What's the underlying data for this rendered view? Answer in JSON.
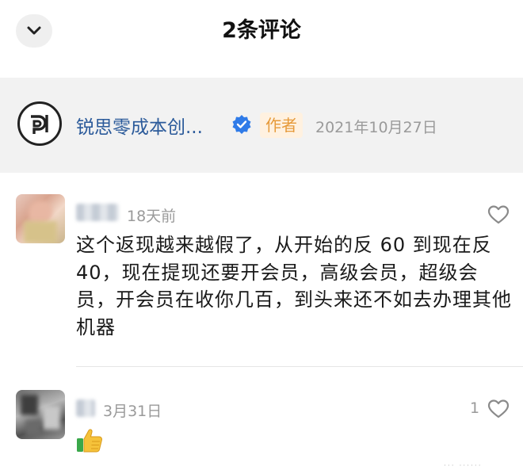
{
  "header": {
    "title": "2条评论",
    "back_icon": "chevron-down-icon"
  },
  "author": {
    "name": "锐思零成本创...",
    "verified_icon": "verified-badge-icon",
    "tag": "作者",
    "date": "2021年10月27日",
    "colors": {
      "name": "#2b5a9a",
      "tag_text": "#e69a3a",
      "tag_bg": "#fff1e0"
    }
  },
  "comments": [
    {
      "time": "18天前",
      "text": "这个返现越来越假了，从开始的反 60 到现在反 40，现在提现还要开会员，高级会员，超级会员，开会员在收你几百，到头来还不如去办理其他机器",
      "like_icon": "heart-outline-icon"
    },
    {
      "time": "3月31日",
      "emoji": "👍",
      "likes": "1",
      "like_icon": "heart-outline-icon"
    }
  ]
}
